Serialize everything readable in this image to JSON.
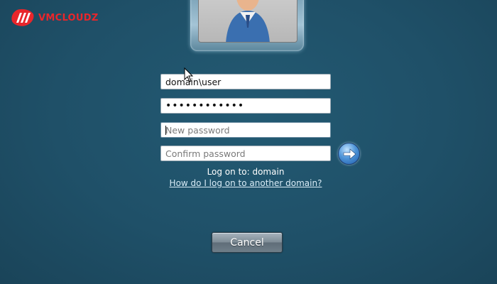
{
  "brand": {
    "logo_text": "VMCLOUDZ",
    "color": "#e8262b"
  },
  "colors": {
    "background": "#1f5068",
    "accent_button": "#4f95d8"
  },
  "form": {
    "username": {
      "value": "domain\\user"
    },
    "password": {
      "value": "••••••••••••"
    },
    "new_password": {
      "value": "",
      "placeholder": "New password"
    },
    "confirm_password": {
      "value": "",
      "placeholder": "Confirm password"
    },
    "submit_icon": "arrow-right-icon"
  },
  "logon": {
    "log_on_to": "Log on to: domain",
    "other_domain_link": "How do I log on to another domain?"
  },
  "actions": {
    "cancel_label": "Cancel"
  }
}
